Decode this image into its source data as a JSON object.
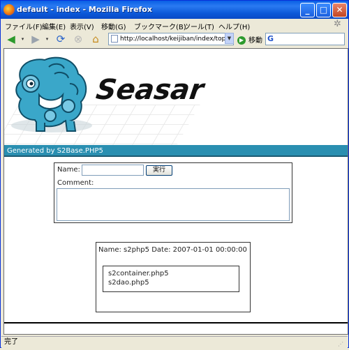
{
  "window": {
    "title": "default - index - Mozilla Firefox",
    "controls": {
      "minimize": "_",
      "maximize": "□",
      "close": "✕"
    }
  },
  "menubar": {
    "items": [
      "ファイル(F)",
      "編集(E)",
      "表示(V)",
      "移動(G)",
      "ブックマーク(B)",
      "ツール(T)",
      "ヘルプ(H)"
    ]
  },
  "navbar": {
    "url": "http://localhost/keijiban/index/top",
    "go_label": "移動",
    "search_value": ""
  },
  "header": {
    "logo_text": "Seasar",
    "generated_by": "Generated by S2Base.PHP5"
  },
  "form": {
    "name_label": "Name:",
    "name_value": "",
    "submit_label": "実行",
    "comment_label": "Comment:",
    "comment_value": ""
  },
  "post": {
    "meta": "Name: s2php5 Date: 2007-01-01 00:00:00",
    "body_lines": [
      "s2container.php5",
      "s2dao.php5"
    ]
  },
  "statusbar": {
    "text": "完了"
  },
  "colors": {
    "titlebar": "#0a5fe5",
    "header_bar": "#2a8fb1",
    "shisa_blue": "#3aa7c9"
  }
}
